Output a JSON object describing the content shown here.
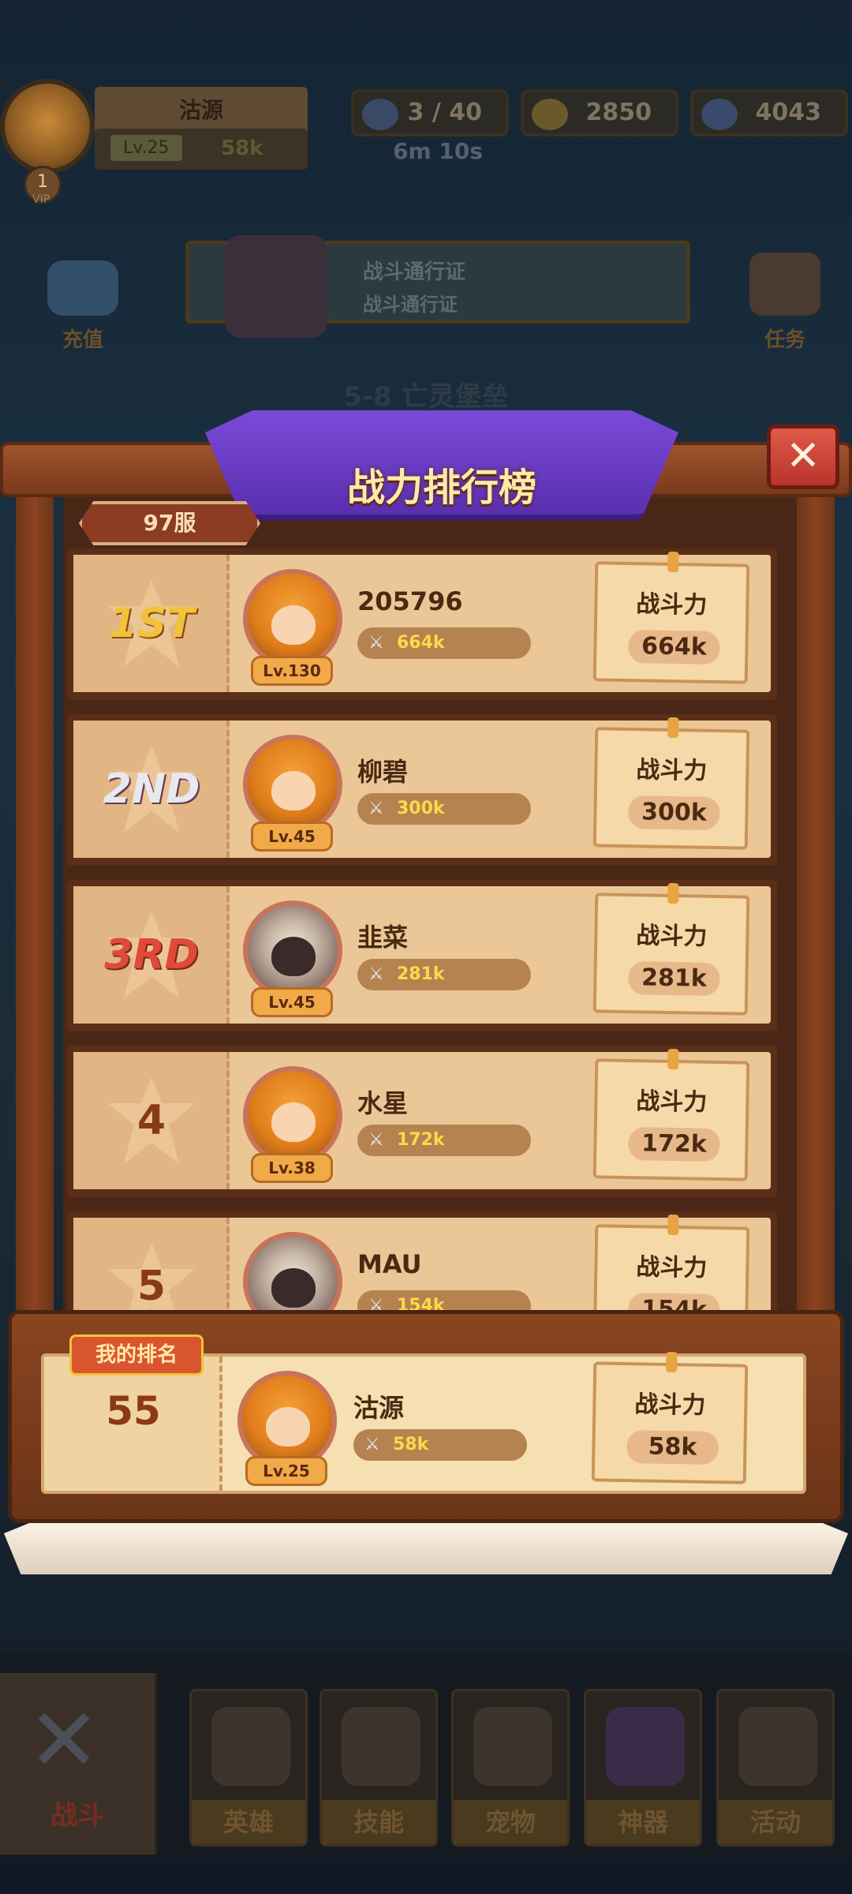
{
  "top_bar": {
    "player_name": "沽源",
    "player_level": "Lv.25",
    "player_power": "58k",
    "vip_level": "1",
    "vip_label": "VIP",
    "energy": "3 / 40",
    "energy_timer": "6m 10s",
    "gold": "2850",
    "gems": "4043"
  },
  "banner": {
    "pass_title": "战斗通行证",
    "pass_subtitle": "战斗通行证",
    "recharge_label": "充值",
    "task_label": "任务",
    "stage_title": "5-8 亡灵堡垒"
  },
  "modal": {
    "title": "战力排行榜",
    "close_icon": "close-icon",
    "server_label": "97服",
    "power_label": "战斗力"
  },
  "rankings": [
    {
      "rank": "1ST",
      "name": "205796",
      "level": "Lv.130",
      "power": "664k",
      "avatar": "orange-hair-hero"
    },
    {
      "rank": "2ND",
      "name": "柳碧",
      "level": "Lv.45",
      "power": "300k",
      "avatar": "orange-hair-hero"
    },
    {
      "rank": "3RD",
      "name": "韭菜",
      "level": "Lv.45",
      "power": "281k",
      "avatar": "hooded-hero"
    },
    {
      "rank": "4",
      "name": "水星",
      "level": "Lv.38",
      "power": "172k",
      "avatar": "orange-hair-hero"
    },
    {
      "rank": "5",
      "name": "MAU",
      "level": "",
      "power": "154k",
      "avatar": "hooded-hero"
    }
  ],
  "my_rank": {
    "tag": "我的排名",
    "rank": "55",
    "name": "沽源",
    "level": "Lv.25",
    "power": "58k"
  },
  "bottom_nav": [
    {
      "label": "战斗",
      "icon": "crossed-swords-icon",
      "active": true
    },
    {
      "label": "英雄",
      "icon": "helmet-icon"
    },
    {
      "label": "技能",
      "icon": "spellbook-icon"
    },
    {
      "label": "宠物",
      "icon": "pet-wings-icon"
    },
    {
      "label": "神器",
      "icon": "locked-artifact-icon"
    },
    {
      "label": "活动",
      "icon": "event-horn-icon"
    }
  ],
  "colors": {
    "panel_bg": "#ebc797",
    "frame_wood": "#8a4420",
    "title_cloth": "#6b3cc8",
    "power_text": "#ffd84a",
    "close_red": "#d0443a"
  }
}
